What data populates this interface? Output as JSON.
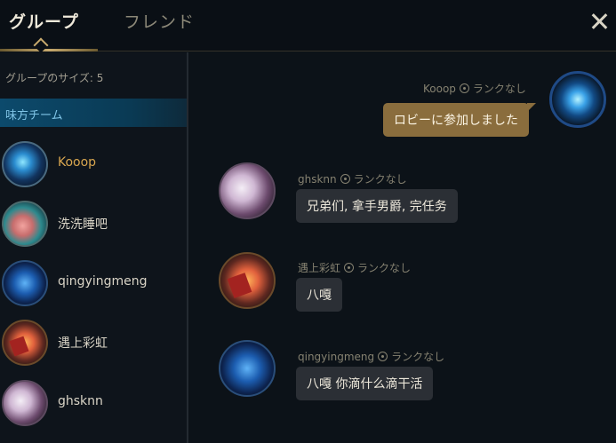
{
  "tabs": [
    {
      "label": "グループ",
      "active": true
    },
    {
      "label": "フレンド",
      "active": false
    }
  ],
  "sidebar": {
    "group_size": "グループのサイズ: 5",
    "team_label": "味方チーム",
    "members": [
      {
        "name": "Kooop",
        "avatar": "blue-emblem-avatar",
        "is_self": true
      },
      {
        "name": "洗洗睡吧",
        "avatar": "teal-creature-avatar",
        "is_self": false
      },
      {
        "name": "qingyingmeng",
        "avatar": "blue-spiky-avatar",
        "is_self": false
      },
      {
        "name": "遇上彩虹",
        "avatar": "party-confetti-avatar",
        "is_self": false
      },
      {
        "name": "ghsknn",
        "avatar": "pale-cat-avatar",
        "is_self": false
      }
    ]
  },
  "messages": [
    {
      "sender": "Kooop",
      "rank": "ランクなし",
      "text": "ロビーに参加しました",
      "is_self": true
    },
    {
      "sender": "ghsknn",
      "rank": "ランクなし",
      "text": "兄弟们, 拿手男爵, 完任务",
      "is_self": false
    },
    {
      "sender": "遇上彩虹",
      "rank": "ランクなし",
      "text": "八嘎",
      "is_self": false
    },
    {
      "sender": "qingyingmeng",
      "rank": "ランクなし",
      "text": "八嘎  你滴什么滴干活",
      "is_self": false
    }
  ],
  "colors": {
    "accent_gold": "#c8aa6e",
    "self_name": "#d8a64f",
    "team_bar": "#0c4a6c",
    "self_bubble": "#8a6d3d"
  }
}
